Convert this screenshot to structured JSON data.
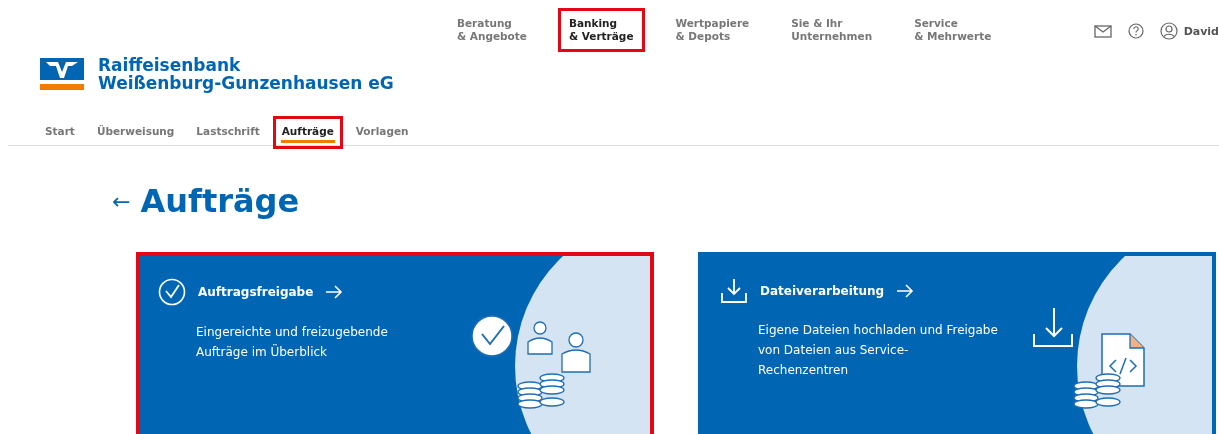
{
  "top_nav": [
    {
      "line1": "Beratung",
      "line2": "& Angebote",
      "selected": false,
      "highlighted": false
    },
    {
      "line1": "Banking",
      "line2": "& Verträge",
      "selected": true,
      "highlighted": true
    },
    {
      "line1": "Wertpapiere",
      "line2": "& Depots",
      "selected": false,
      "highlighted": false
    },
    {
      "line1": "Sie & Ihr",
      "line2": "Unternehmen",
      "selected": false,
      "highlighted": false
    },
    {
      "line1": "Service",
      "line2": "& Mehrwerte",
      "selected": false,
      "highlighted": false
    }
  ],
  "user": {
    "name": "David"
  },
  "logo": {
    "line1": "Raiffeisenbank",
    "line2": "Weißenburg-Gunzenhausen eG"
  },
  "sub_nav": [
    {
      "label": "Start",
      "selected": false,
      "highlighted": false
    },
    {
      "label": "Überweisung",
      "selected": false,
      "highlighted": false
    },
    {
      "label": "Lastschrift",
      "selected": false,
      "highlighted": false
    },
    {
      "label": "Aufträge",
      "selected": true,
      "highlighted": true
    },
    {
      "label": "Vorlagen",
      "selected": false,
      "highlighted": false
    }
  ],
  "page": {
    "back": "←",
    "title": "Aufträge"
  },
  "cards": [
    {
      "kind": "approval",
      "title": "Auftragsfreigabe",
      "description": "Eingereichte und freizugebende Aufträge im Überblick",
      "highlighted": true
    },
    {
      "kind": "files",
      "title": "Dateiverarbeitung",
      "description": "Eigene Dateien hochladen und Freigabe von Dateien aus Service-Rechenzentren",
      "highlighted": false
    }
  ]
}
